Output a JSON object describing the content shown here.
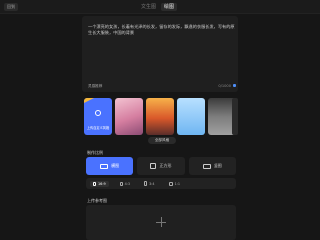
{
  "topbar": {
    "back_label": "回到",
    "tabs": [
      {
        "label": "文生图"
      },
      {
        "label": "绘图"
      }
    ]
  },
  "prompt": {
    "text": "一个漂亮的女孩，长着有光泽的长发，留存的发际，飘逸的衣服长发，写有的原生长大服装，中国的背景",
    "inspire_label": "灵感推荐",
    "counter": "0/1000"
  },
  "styles": {
    "custom_label": "上传自定义风格",
    "cards": [
      {
        "label": ""
      },
      {
        "label": ""
      },
      {
        "label": ""
      },
      {
        "label": ""
      }
    ],
    "more_label": "全部风格"
  },
  "ratio": {
    "section_title": "制作比例",
    "options": [
      {
        "label": "横图",
        "active": true
      },
      {
        "label": "正方形",
        "active": false
      },
      {
        "label": "竖图",
        "active": false
      }
    ]
  },
  "size": {
    "options": [
      {
        "label": "16:9"
      },
      {
        "label": "4:3"
      },
      {
        "label": "3:4"
      },
      {
        "label": "1:1"
      }
    ]
  },
  "upload": {
    "section_title": "上传参考图"
  }
}
